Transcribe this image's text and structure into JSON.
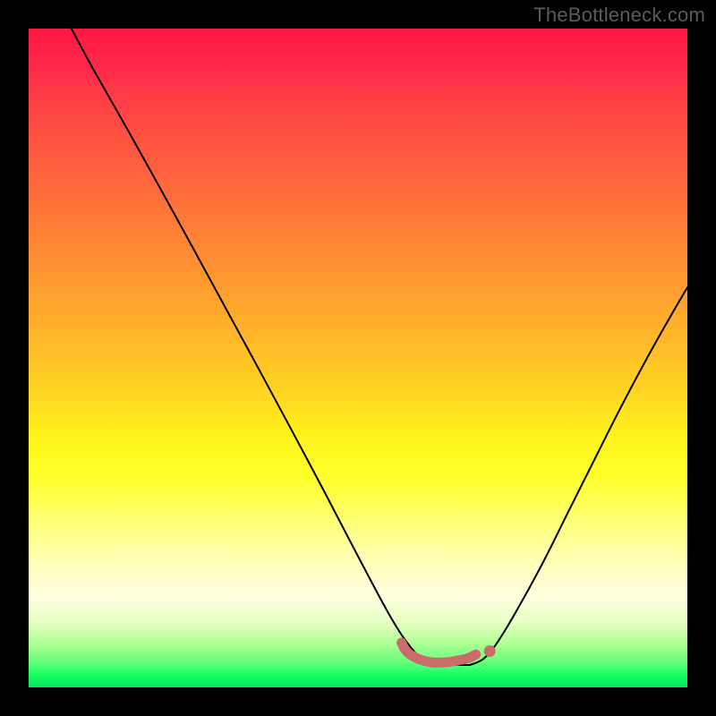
{
  "watermark": "TheBottleneck.com",
  "colors": {
    "frame_background": "#000000",
    "curve_stroke": "#000000",
    "ridge_stroke": "#cc6b6b",
    "watermark_text": "#5b5b5b",
    "gradient_top": "#ff1744",
    "gradient_bottom": "#00e85b"
  },
  "chart_data": {
    "type": "line",
    "title": "",
    "xlabel": "",
    "ylabel": "",
    "xlim": [
      0,
      1
    ],
    "ylim": [
      0,
      1
    ],
    "grid": false,
    "legend": false,
    "annotations": [
      "TheBottleneck.com"
    ],
    "note": "x and y are normalized 0–1; background is a bottleneck heatmap gradient where green (y≈0) = no bottleneck and red (y≈1) = severe bottleneck",
    "series": [
      {
        "name": "bottleneck-curve-left",
        "x": [
          0.065,
          0.1,
          0.15,
          0.2,
          0.25,
          0.3,
          0.35,
          0.4,
          0.45,
          0.5,
          0.55,
          0.58,
          0.6,
          0.63,
          0.67
        ],
        "y": [
          1.0,
          0.935,
          0.847,
          0.757,
          0.666,
          0.574,
          0.482,
          0.389,
          0.295,
          0.199,
          0.106,
          0.061,
          0.043,
          0.035,
          0.034
        ]
      },
      {
        "name": "bottleneck-curve-right",
        "x": [
          0.67,
          0.69,
          0.71,
          0.74,
          0.78,
          0.82,
          0.86,
          0.9,
          0.94,
          0.98,
          1.0
        ],
        "y": [
          0.034,
          0.043,
          0.066,
          0.115,
          0.188,
          0.268,
          0.348,
          0.427,
          0.502,
          0.573,
          0.607
        ]
      },
      {
        "name": "optimal-ridge",
        "x": [
          0.566,
          0.571,
          0.579,
          0.592,
          0.611,
          0.634,
          0.652,
          0.666,
          0.679
        ],
        "y": [
          0.068,
          0.058,
          0.05,
          0.043,
          0.038,
          0.038,
          0.041,
          0.044,
          0.05
        ]
      }
    ],
    "markers": [
      {
        "name": "ridge-end-dot",
        "x": 0.7,
        "y": 0.055
      }
    ]
  }
}
